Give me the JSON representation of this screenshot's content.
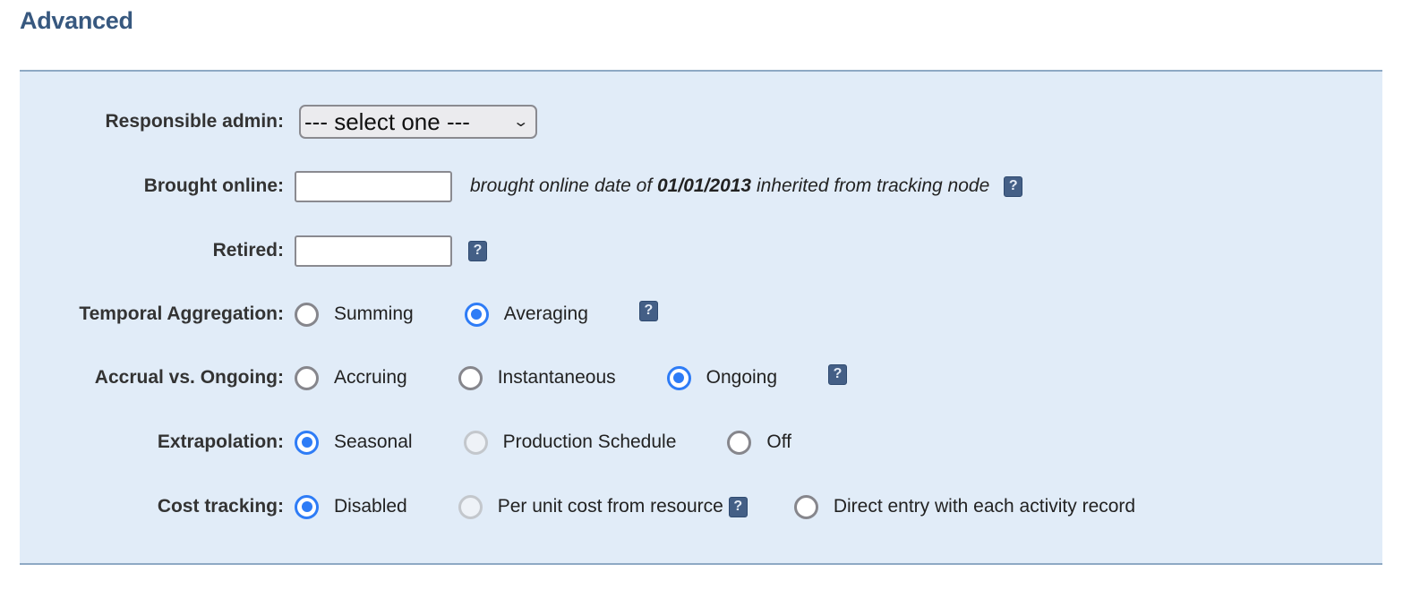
{
  "section": {
    "title": "Advanced"
  },
  "responsible_admin": {
    "label": "Responsible admin:",
    "selected": "--- select one ---"
  },
  "brought_online": {
    "label": "Brought online:",
    "value": "",
    "note_prefix": "brought online date of ",
    "note_date": "01/01/2013",
    "note_suffix": " inherited from tracking node",
    "help": "?"
  },
  "retired": {
    "label": "Retired:",
    "value": "",
    "help": "?"
  },
  "temporal_aggregation": {
    "label": "Temporal Aggregation:",
    "options": [
      {
        "label": "Summing",
        "checked": false,
        "disabled": false
      },
      {
        "label": "Averaging",
        "checked": true,
        "disabled": false
      }
    ],
    "help": "?"
  },
  "accrual": {
    "label": "Accrual vs. Ongoing:",
    "options": [
      {
        "label": "Accruing",
        "checked": false,
        "disabled": false
      },
      {
        "label": "Instantaneous",
        "checked": false,
        "disabled": false
      },
      {
        "label": "Ongoing",
        "checked": true,
        "disabled": false
      }
    ],
    "help": "?"
  },
  "extrapolation": {
    "label": "Extrapolation:",
    "options": [
      {
        "label": "Seasonal",
        "checked": true,
        "disabled": false
      },
      {
        "label": "Production Schedule",
        "checked": false,
        "disabled": true
      },
      {
        "label": "Off",
        "checked": false,
        "disabled": false
      }
    ]
  },
  "cost_tracking": {
    "label": "Cost tracking:",
    "options": [
      {
        "label": "Disabled",
        "checked": true,
        "disabled": false
      },
      {
        "label": "Per unit cost from resource",
        "checked": false,
        "disabled": true
      },
      {
        "label": "Direct entry with each activity record",
        "checked": false,
        "disabled": false
      }
    ],
    "help": "?"
  },
  "colors": {
    "title": "#37587f",
    "panel_bg": "#e1ecf8",
    "accent": "#2e7cf6",
    "help_icon": "#445f86"
  }
}
